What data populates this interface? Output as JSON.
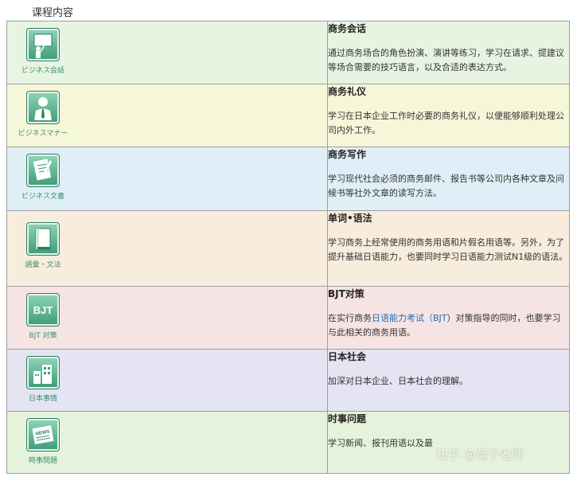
{
  "page_title": "课程内容",
  "courses": [
    {
      "icon_label": "ビジネス会話",
      "title": "商务会话",
      "desc": "通过商务场合的角色扮演、演讲等练习，学习在请求、提建议等场合需要的技巧语言，以及合适的表达方式。"
    },
    {
      "icon_label": "ビジネスマナー",
      "title": "商务礼仪",
      "desc": "学习在日本企业工作时必要的商务礼仪，以便能够顺利处理公司内外工作。"
    },
    {
      "icon_label": "ビジネス文書",
      "title": "商务写作",
      "desc": "学习现代社会必须的商务邮件、报告书等公司内各种文章及问候书等社外文章的读写方法。"
    },
    {
      "icon_label": "語彙・文法",
      "title": "单词•语法",
      "desc": "学习商务上经常使用的商务用语和片假名用语等。另外，为了提升基础日语能力，也要同时学习日语能力测试N1级的语法。"
    },
    {
      "icon_label": "BJT 対策",
      "icon_text": "BJT",
      "title": "BJT对策",
      "desc_pre": "在实行商务",
      "desc_link": "日语能力考试（BJT",
      "desc_post": "）对策指导的同时，也要学习与此相关的商务用语。"
    },
    {
      "icon_label": "日本事情",
      "title": "日本社会",
      "desc": "加深对日本企业、日本社会的理解。"
    },
    {
      "icon_label": "時事問題",
      "icon_text": "NEWS",
      "title": "时事问题",
      "desc": "学习新闻、报刊用语以及最"
    }
  ],
  "watermark": "知乎 @葉子老师",
  "colors": {
    "icon_green": "#3e9b78",
    "link_blue": "#1e6fb8"
  }
}
